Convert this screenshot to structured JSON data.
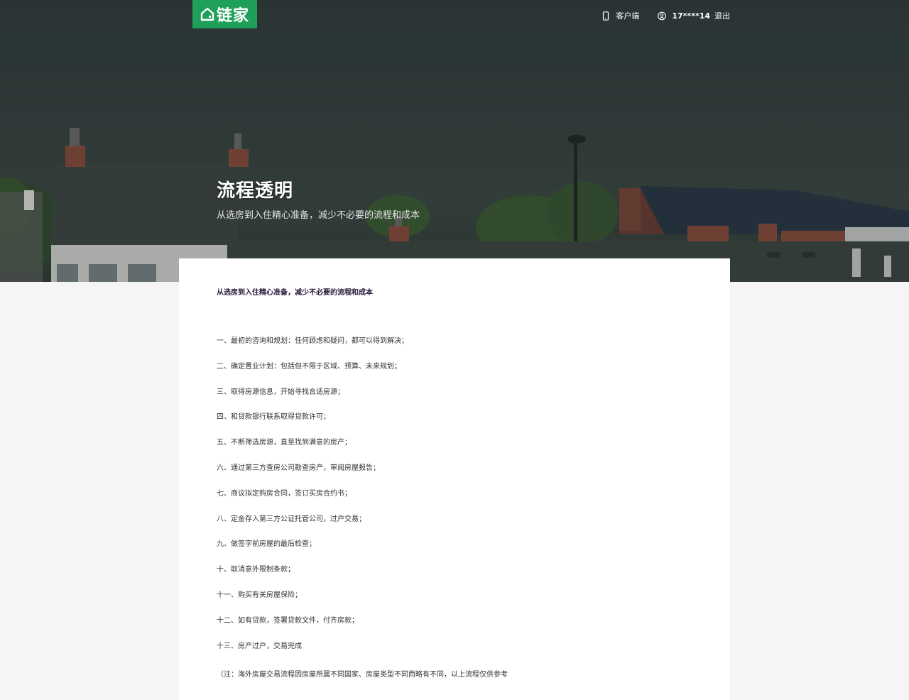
{
  "header": {
    "logo_text": "链家",
    "logo_icon": "house-icon",
    "client_label": "客户端",
    "client_icon": "phone-icon",
    "user_icon": "user-circle-icon",
    "user_name": "17****14",
    "logout_label": "退出"
  },
  "hero": {
    "title": "流程透明",
    "subtitle": "从选房到入住精心准备，减少不必要的流程和成本"
  },
  "content": {
    "heading": "从选房到入住精心准备，减少不必要的流程和成本",
    "steps": [
      "一、最初的咨询和规划：任何顾虑和疑问，都可以得到解决；",
      "二、确定置业计划：包括但不限于区域、预算、未来规划；",
      "三、取得房源信息，开始寻找合适房源；",
      "四、和贷款银行联系取得贷款许可；",
      "五、不断筛选房源，直至找到满意的房产；",
      "六、通过第三方查房公司勘查房产，审阅房屋报告；",
      "七、商议拟定购房合同，签订买房合约书；",
      "八、定金存入第三方公证托管公司，过户交易；",
      "九、做签字前房屋的最后检查；",
      "十、取消意外限制条款；",
      "十一、购买有关房屋保险；",
      "十二、如有贷款，签署贷款文件，付齐房款；",
      "十三、房产过户，交易完成"
    ],
    "note": "（注：海外房屋交易流程因房屋所属不同国家、房屋类型不同而略有不同，以上流程仅供参考"
  },
  "colors": {
    "brand_green": "#1fa05a",
    "page_background": "#f5f5f5",
    "card_background": "#ffffff"
  }
}
